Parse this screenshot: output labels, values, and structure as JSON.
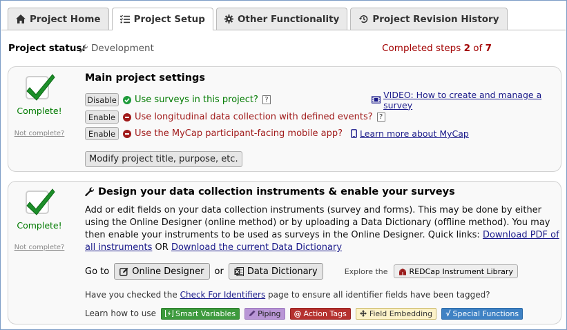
{
  "tabs": [
    {
      "label": "Project Home",
      "icon": "home-icon"
    },
    {
      "label": "Project Setup",
      "icon": "list-icon"
    },
    {
      "label": "Other Functionality",
      "icon": "gear-icon"
    },
    {
      "label": "Project Revision History",
      "icon": "history-icon"
    }
  ],
  "active_tab": "Project Setup",
  "status": {
    "label": "Project status:",
    "value": "Development",
    "steps_prefix": "Completed steps",
    "steps_done": "2",
    "steps_of": "of",
    "steps_total": "7"
  },
  "main_settings": {
    "complete": "Complete!",
    "not_complete": "Not complete?",
    "title": "Main project settings",
    "options": [
      {
        "button": "Disable",
        "text": "Use surveys in this project?",
        "state": "enabled",
        "help": "?"
      },
      {
        "button": "Enable",
        "text": "Use longitudinal data collection with defined events?",
        "state": "disabled",
        "help": "?"
      },
      {
        "button": "Enable",
        "text": "Use the MyCap participant-facing mobile app?",
        "state": "disabled"
      }
    ],
    "video_link": "VIDEO: How to create and manage a survey",
    "mycap_link": "Learn more about MyCap",
    "modify_button": "Modify project title, purpose, etc."
  },
  "design": {
    "complete": "Complete!",
    "not_complete": "Not complete?",
    "title": "Design your data collection instruments & enable your surveys",
    "para_text": "Add or edit fields on your data collection instruments (survey and forms). This may be done by either using the Online Designer (online method) or by uploading a Data Dictionary (offline method). You may then enable your instruments to be used as surveys in the Online Designer. Quick links:",
    "pdf_link": "Download PDF of all instruments",
    "or_text": "OR",
    "dd_link": "Download the current Data Dictionary",
    "goto": "Go to",
    "online_designer": "Online Designer",
    "or2": "or",
    "data_dictionary": "Data Dictionary",
    "explore": "Explore the",
    "library": "REDCap Instrument Library",
    "ids_prefix": "Have you checked the",
    "ids_link": "Check For Identifiers",
    "ids_suffix": "page to ensure all identifier fields have been tagged?",
    "learn": "Learn how to use",
    "chips": [
      "Smart Variables",
      "Piping",
      "Action Tags",
      "Field Embedding",
      "Special Functions"
    ]
  },
  "colors": {
    "complete_green": "#007a00",
    "incomplete_red": "#a01a1a",
    "steps_red": "#a20000",
    "link_blue": "#1a1a8a"
  }
}
